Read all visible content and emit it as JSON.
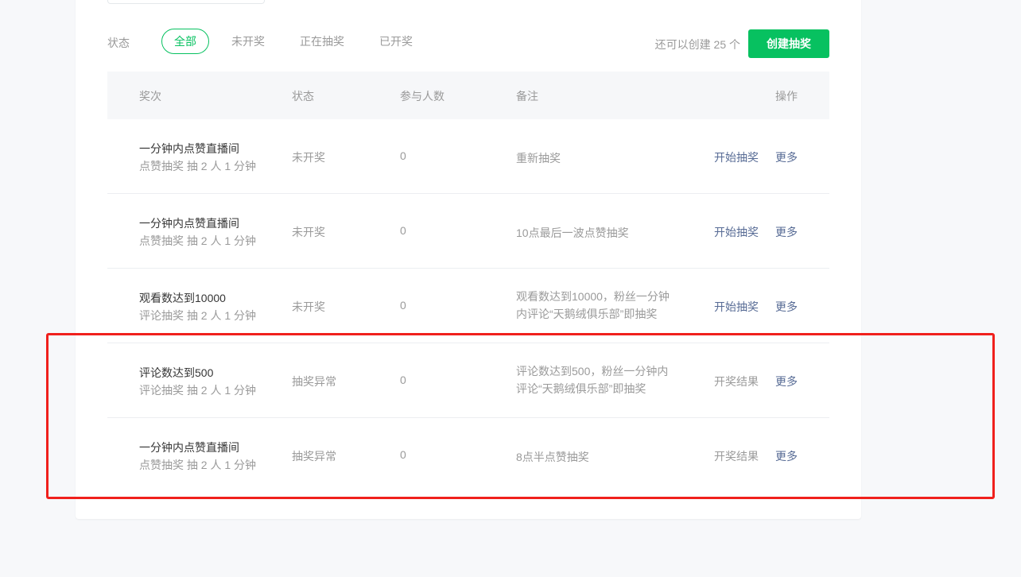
{
  "filter": {
    "label": "状态",
    "tabs": [
      {
        "label": "全部",
        "active": true
      },
      {
        "label": "未开奖",
        "active": false
      },
      {
        "label": "正在抽奖",
        "active": false
      },
      {
        "label": "已开奖",
        "active": false
      }
    ],
    "remaining_text": "还可以创建 25 个",
    "create_button": "创建抽奖"
  },
  "table": {
    "headers": {
      "name": "奖次",
      "status": "状态",
      "count": "参与人数",
      "note": "备注",
      "op": "操作"
    },
    "rows": [
      {
        "title": "一分钟内点赞直播间",
        "sub": "点赞抽奖 抽 2 人  1 分钟",
        "status": "未开奖",
        "count": "0",
        "note_line1": "重新抽奖",
        "note_line2": "",
        "op_primary": "开始抽奖",
        "op_more": "更多"
      },
      {
        "title": "一分钟内点赞直播间",
        "sub": "点赞抽奖 抽 2 人  1 分钟",
        "status": "未开奖",
        "count": "0",
        "note_line1": "10点最后一波点赞抽奖",
        "note_line2": "",
        "op_primary": "开始抽奖",
        "op_more": "更多"
      },
      {
        "title": "观看数达到10000",
        "sub": "评论抽奖 抽 2 人  1 分钟",
        "status": "未开奖",
        "count": "0",
        "note_line1": "观看数达到10000，粉丝一分钟",
        "note_line2": "内评论“天鹅绒俱乐部”即抽奖",
        "op_primary": "开始抽奖",
        "op_more": "更多"
      },
      {
        "title": "评论数达到500",
        "sub": "评论抽奖 抽 2 人  1 分钟",
        "status": "抽奖异常",
        "count": "0",
        "note_line1": "评论数达到500，粉丝一分钟内",
        "note_line2": "评论“天鹅绒俱乐部”即抽奖",
        "op_primary": "开奖结果",
        "op_more": "更多"
      },
      {
        "title": "一分钟内点赞直播间",
        "sub": "点赞抽奖 抽 2 人  1 分钟",
        "status": "抽奖异常",
        "count": "0",
        "note_line1": "8点半点赞抽奖",
        "note_line2": "",
        "op_primary": "开奖结果",
        "op_more": "更多"
      }
    ]
  },
  "colors": {
    "brand_green": "#07c160",
    "link_blue": "#576b95",
    "highlight_red": "#f0201c"
  }
}
